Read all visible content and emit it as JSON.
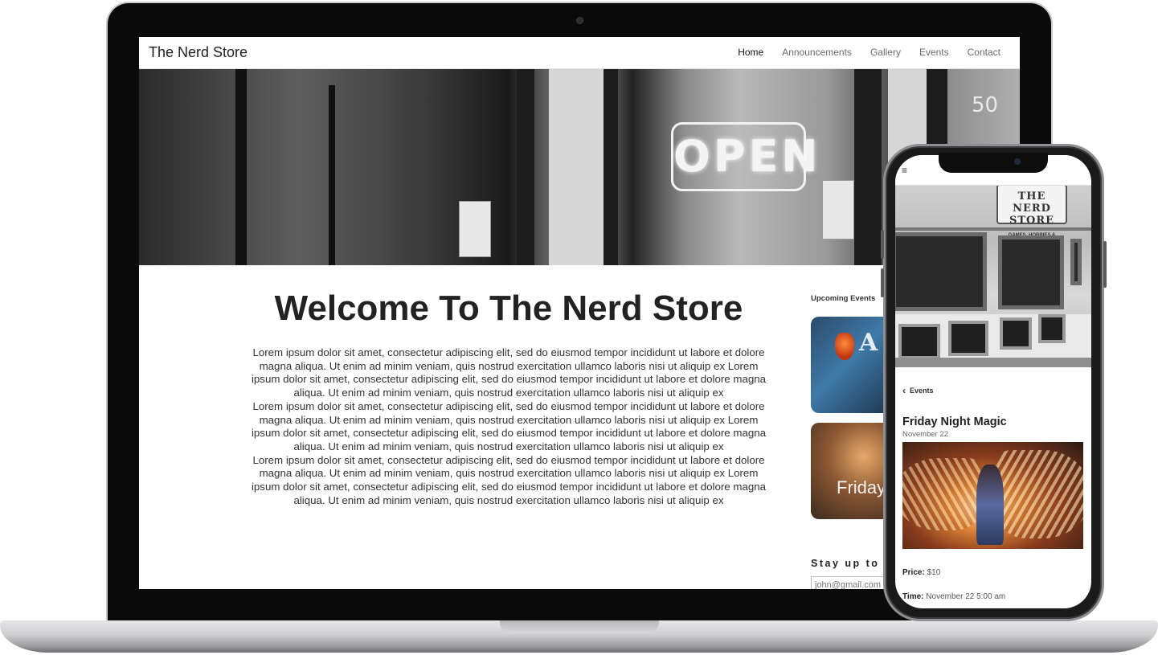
{
  "desktop": {
    "brand": "The Nerd Store",
    "nav": [
      "Home",
      "Announcements",
      "Gallery",
      "Events",
      "Contact"
    ],
    "hero_sign": "OPEN",
    "hero_number": "50",
    "welcome_title": "Welcome To The Nerd Store",
    "paragraphs": [
      "Lorem ipsum dolor sit amet, consectetur adipiscing elit, sed do eiusmod tempor incididunt ut labore et dolore magna aliqua. Ut enim ad minim veniam, quis nostrud exercitation ullamco laboris nisi ut aliquip ex Lorem ipsum dolor sit amet, consectetur adipiscing elit, sed do eiusmod tempor incididunt ut labore et dolore magna aliqua. Ut enim ad minim veniam, quis nostrud exercitation ullamco laboris nisi ut aliquip ex",
      "Lorem ipsum dolor sit amet, consectetur adipiscing elit, sed do eiusmod tempor incididunt ut labore et dolore magna aliqua. Ut enim ad minim veniam, quis nostrud exercitation ullamco laboris nisi ut aliquip ex Lorem ipsum dolor sit amet, consectetur adipiscing elit, sed do eiusmod tempor incididunt ut labore et dolore magna aliqua. Ut enim ad minim veniam, quis nostrud exercitation ullamco laboris nisi ut aliquip ex",
      "Lorem ipsum dolor sit amet, consectetur adipiscing elit, sed do eiusmod tempor incididunt ut labore et dolore magna aliqua. Ut enim ad minim veniam, quis nostrud exercitation ullamco laboris nisi ut aliquip ex Lorem ipsum dolor sit amet, consectetur adipiscing elit, sed do eiusmod tempor incididunt ut labore et dolore magna aliqua. Ut enim ad minim veniam, quis nostrud exercitation ullamco laboris nisi ut aliquip ex"
    ],
    "sidebar": {
      "title": "Upcoming Events",
      "card_1_text": "MA",
      "card_1_sub": "A",
      "card_2_text": "Friday",
      "stay_label": "Stay up to D",
      "email_placeholder": "john@gmail.com"
    }
  },
  "mobile": {
    "brand": "The Nerd Store",
    "menu_icon": "hamburger-icon",
    "sign_logo": "THE NERD STORE",
    "sign_sub": "GAMES, HOBBIES & COLLECTIBLES",
    "back_label": "Events",
    "event_title": "Friday Night Magic",
    "event_date": "November 22",
    "price_label": "Price:",
    "price_value": "$10",
    "time_label": "Time:",
    "time_value": "November 22 5:00 am"
  }
}
